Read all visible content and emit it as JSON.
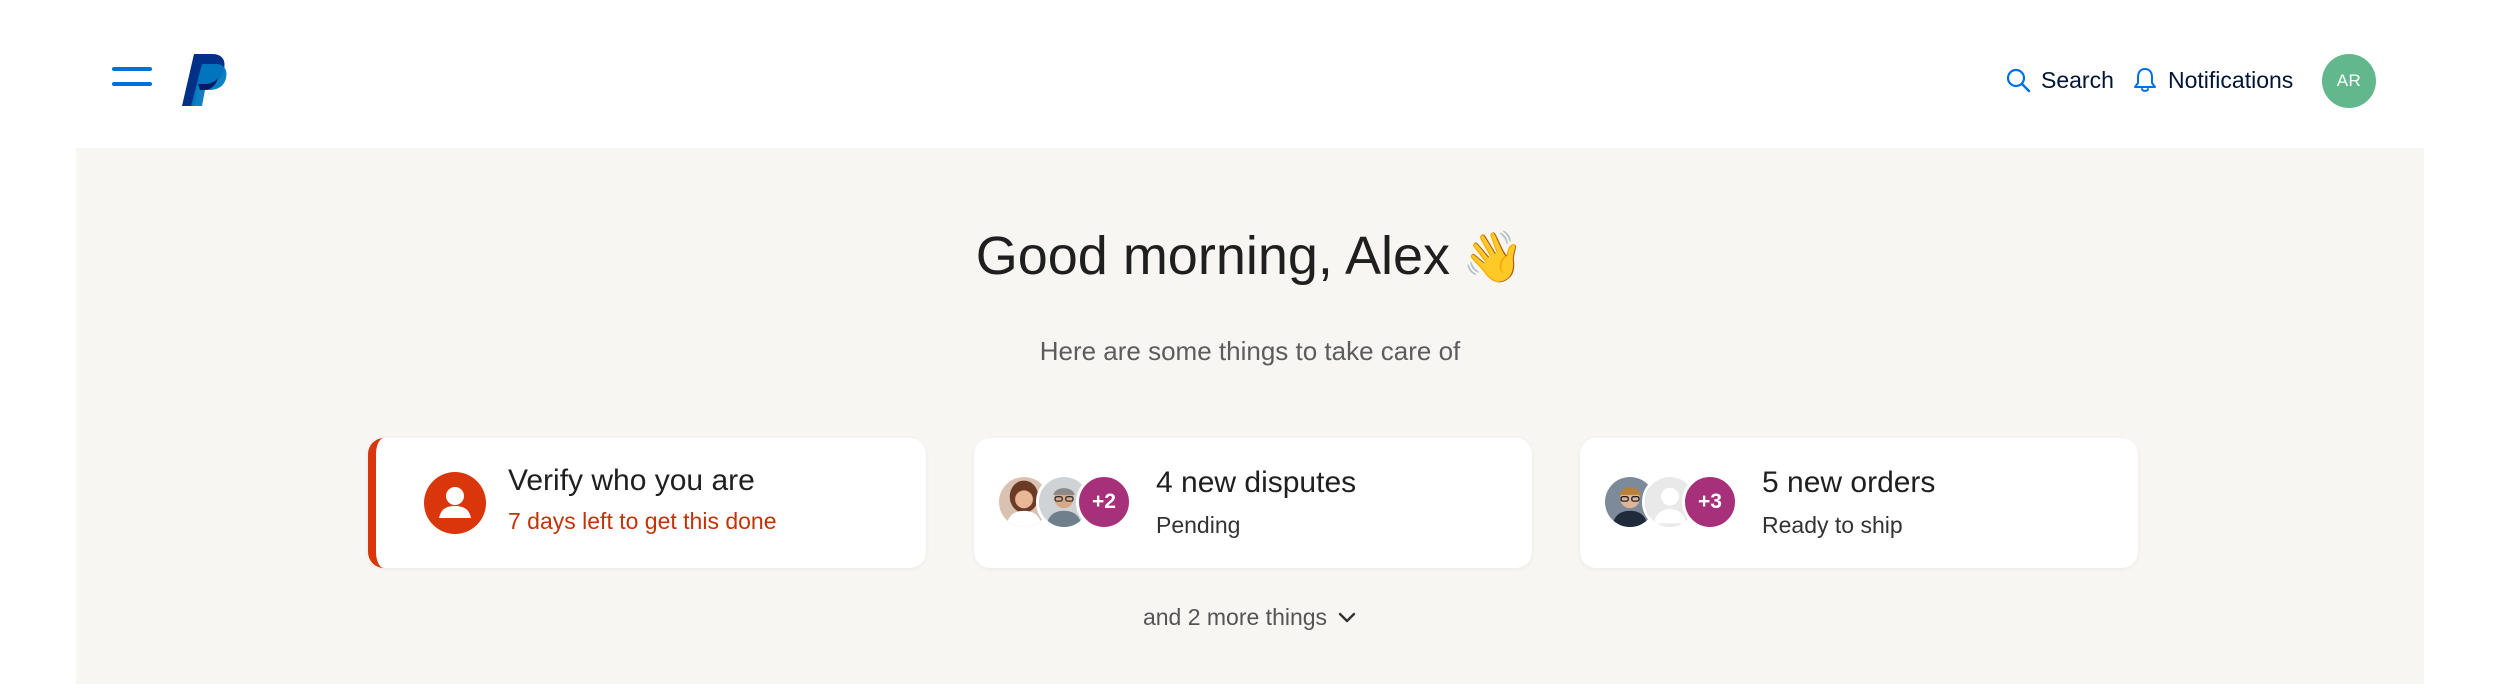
{
  "header": {
    "menu_icon": "hamburger-menu-icon",
    "logo_icon": "paypal-logo",
    "search_label": "Search",
    "notifications_label": "Notifications",
    "user_initials": "AR",
    "colors": {
      "accent": "#0070e0",
      "avatar": "#62b78d"
    }
  },
  "main": {
    "greeting": "Good morning, Alex",
    "greeting_emoji": "👋",
    "subtitle": "Here are some things to take care of",
    "cards": [
      {
        "title": "Verify who you are",
        "subtitle": "7 days left to get this done",
        "icon": "person-icon",
        "status_color": "#d9360b"
      },
      {
        "title": "4 new disputes",
        "subtitle": "Pending",
        "more_count": "+2"
      },
      {
        "title": "5 new orders",
        "subtitle": "Ready to ship",
        "more_count": "+3"
      }
    ],
    "more_things_label": "and 2 more things",
    "more_icon": "chevron-down-icon",
    "colors": {
      "panel_bg": "#f7f6f3",
      "badge": "#a7307a"
    }
  }
}
